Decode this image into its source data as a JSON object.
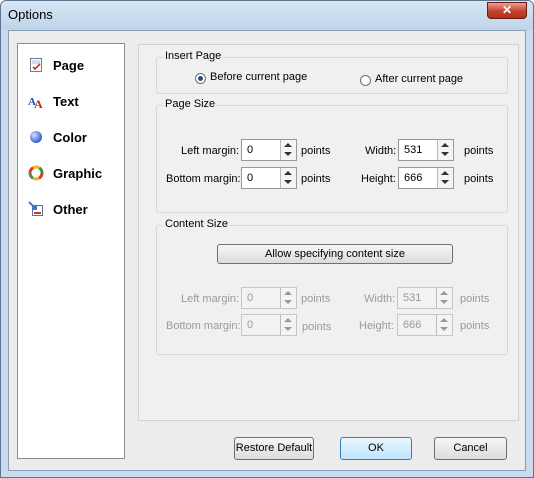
{
  "window": {
    "title": "Options",
    "close_label": "✕"
  },
  "sidebar": {
    "items": [
      {
        "label": "Page",
        "icon": "page-icon"
      },
      {
        "label": "Text",
        "icon": "text-icon"
      },
      {
        "label": "Color",
        "icon": "color-icon"
      },
      {
        "label": "Graphic",
        "icon": "graphic-icon"
      },
      {
        "label": "Other",
        "icon": "other-icon"
      }
    ]
  },
  "insert_page": {
    "title": "Insert Page",
    "before_label": "Before current page",
    "after_label": "After current page",
    "selected": "before"
  },
  "page_size": {
    "title": "Page Size",
    "left_margin_label": "Left margin:",
    "left_margin_value": "0",
    "bottom_margin_label": "Bottom margin:",
    "bottom_margin_value": "0",
    "width_label": "Width:",
    "width_value": "531",
    "height_label": "Height:",
    "height_value": "666",
    "units": "points"
  },
  "content_size": {
    "title": "Content Size",
    "allow_button_label": "Allow specifying content size",
    "left_margin_label": "Left margin:",
    "left_margin_value": "0",
    "bottom_margin_label": "Bottom margin:",
    "bottom_margin_value": "0",
    "width_label": "Width:",
    "width_value": "531",
    "height_label": "Height:",
    "height_value": "666",
    "units": "points"
  },
  "buttons": {
    "restore_default": "Restore Default",
    "ok": "OK",
    "cancel": "Cancel"
  }
}
